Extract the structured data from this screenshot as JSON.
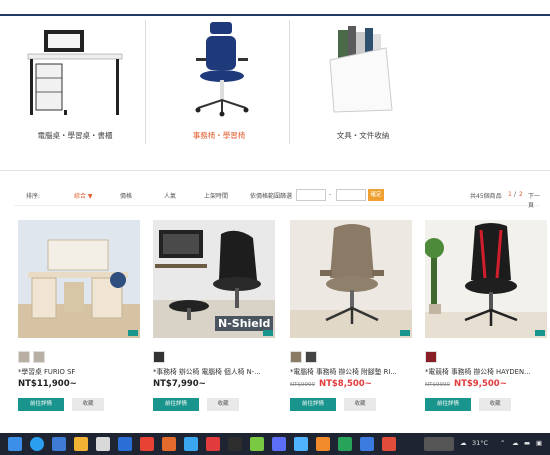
{
  "categories": [
    {
      "label": "電腦桌・學習桌・書櫃",
      "active": false
    },
    {
      "label": "事務椅・學習椅",
      "active": true
    },
    {
      "label": "文具・文件收納",
      "active": false
    }
  ],
  "sortbar": {
    "sort_label": "排序:",
    "options": [
      "綜合",
      "價格",
      "人氣",
      "上架時間"
    ],
    "active_option": "綜合",
    "price_filter_label": "依價格範圍篩選",
    "dash": "-",
    "ok": "確定",
    "result_text": "共45個商品",
    "page_current": "1",
    "page_sep": "/",
    "page_total": "2",
    "next": "下一頁"
  },
  "products": [
    {
      "name": "*學習桌 FURIO SF",
      "price": "NT$11,900~",
      "old_price": "",
      "sale": false,
      "buy_label": "前往詳情",
      "fav_label": "收藏",
      "thumbs": 2
    },
    {
      "name": "*事務椅 辦公椅 電腦椅 個人椅 N-...",
      "price": "NT$7,990~",
      "old_price": "",
      "sale": false,
      "buy_label": "前往詳情",
      "fav_label": "收藏",
      "thumbs": 1
    },
    {
      "name": "*電腦椅 事務椅 辦公椅 附腳墊 RI...",
      "price": "NT$8,500~",
      "old_price": "NT$9990",
      "sale": true,
      "buy_label": "前往詳情",
      "fav_label": "收藏",
      "thumbs": 2
    },
    {
      "name": "*電競椅 事務椅 辦公椅 HAYDEN...",
      "price": "NT$9,500~",
      "old_price": "NT$9990",
      "sale": true,
      "buy_label": "前往詳情",
      "fav_label": "收藏",
      "thumbs": 1
    }
  ],
  "product_logo_text": "N-Shield",
  "taskbar": {
    "temperature": "31°C",
    "colors": [
      "#2b6fd6",
      "#2a9ff0",
      "#3e7bd4",
      "#f2b233",
      "#d9d9d9",
      "#e84235",
      "#e26a2c",
      "#3aa6f0",
      "#e23b3b",
      "#7ac943",
      "#5b6ef5",
      "#4fb3ff",
      "#f28b2c",
      "#27a35a",
      "#e24c3b"
    ]
  }
}
